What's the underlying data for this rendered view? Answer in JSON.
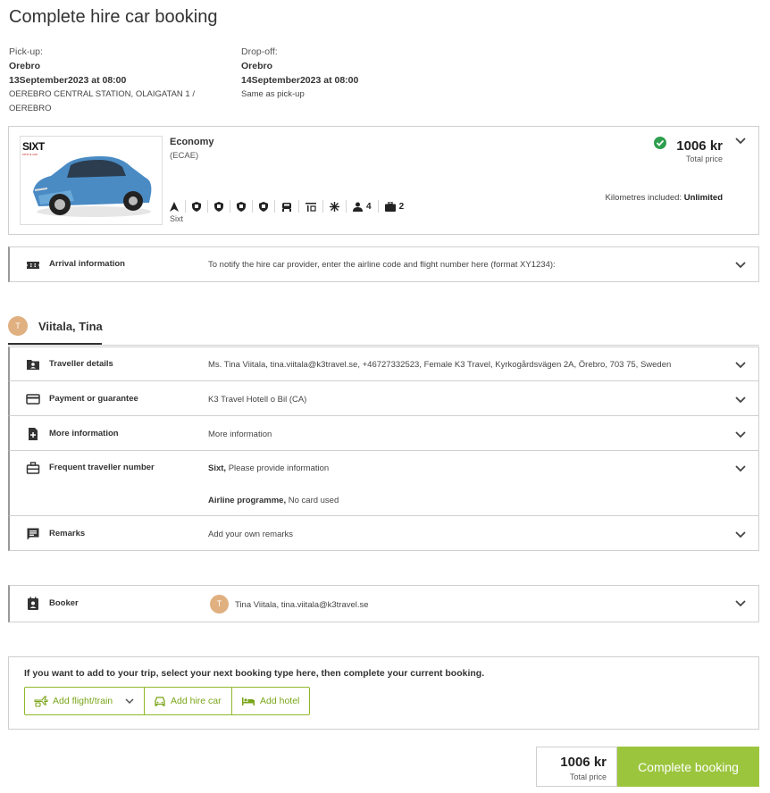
{
  "page": {
    "title": "Complete hire car booking"
  },
  "pickup": {
    "label": "Pick-up:",
    "city": "Orebro",
    "datetime": "13September2023 at 08:00",
    "address_line1": "OEREBRO CENTRAL STATION, OLAIGATAN 1 /",
    "address_line2": "OEREBRO"
  },
  "dropoff": {
    "label": "Drop-off:",
    "city": "Orebro",
    "datetime": "14September2023 at 08:00",
    "note": "Same as pick-up"
  },
  "car": {
    "category": "Economy",
    "code": "(ECAE)",
    "supplier": "Sixt",
    "brand_logo_text": "SIXT",
    "brand_logo_sub": "rent a car",
    "price": "1006 kr",
    "price_label": "Total price",
    "km_label": "Kilometres included:",
    "km_value": "Unlimited",
    "passengers": "4",
    "bags": "2",
    "features": [
      "navigation-icon",
      "shield-icon",
      "shield-icon",
      "shield-icon",
      "shield-icon",
      "car-seat-icon",
      "transmission-icon",
      "air-conditioning-icon",
      "passengers-icon",
      "luggage-icon"
    ],
    "status_color": "#2e9e4f"
  },
  "arrival": {
    "label": "Arrival information",
    "value": "To notify the hire car provider, enter the airline code and flight number here (format XY1234):"
  },
  "traveller": {
    "initial": "T",
    "name": "Viitala, Tina",
    "rows": {
      "details": {
        "label": "Traveller details",
        "value": "Ms. Tina Viitala, tina.viitala@k3travel.se, +46727332523, Female K3 Travel, Kyrkogårdsvägen 2A, Örebro, 703 75, Sweden"
      },
      "payment": {
        "label": "Payment or guarantee",
        "value": "K3 Travel Hotell o Bil (CA)"
      },
      "more": {
        "label": "More information",
        "value": "More information"
      },
      "frequent": {
        "label": "Frequent traveller number",
        "line1_bold": "Sixt,",
        "line1_rest": " Please provide information",
        "line2_bold": "Airline programme,",
        "line2_rest": " No card used"
      },
      "remarks": {
        "label": "Remarks",
        "value": "Add your own remarks"
      }
    }
  },
  "booker": {
    "label": "Booker",
    "initial": "T",
    "value": "Tina Viitala, tina.viitala@k3travel.se"
  },
  "add_to_trip": {
    "text": "If you want to add to your trip, select your next booking type here, then complete your current booking.",
    "flight_train": "Add flight/train",
    "hire_car": "Add hire car",
    "hotel": "Add hotel"
  },
  "footer": {
    "total": "1006 kr",
    "total_label": "Total price",
    "complete": "Complete booking"
  },
  "colors": {
    "accent": "#9bc53d",
    "accent_text": "#7aa51a",
    "avatar": "#e0b080"
  }
}
